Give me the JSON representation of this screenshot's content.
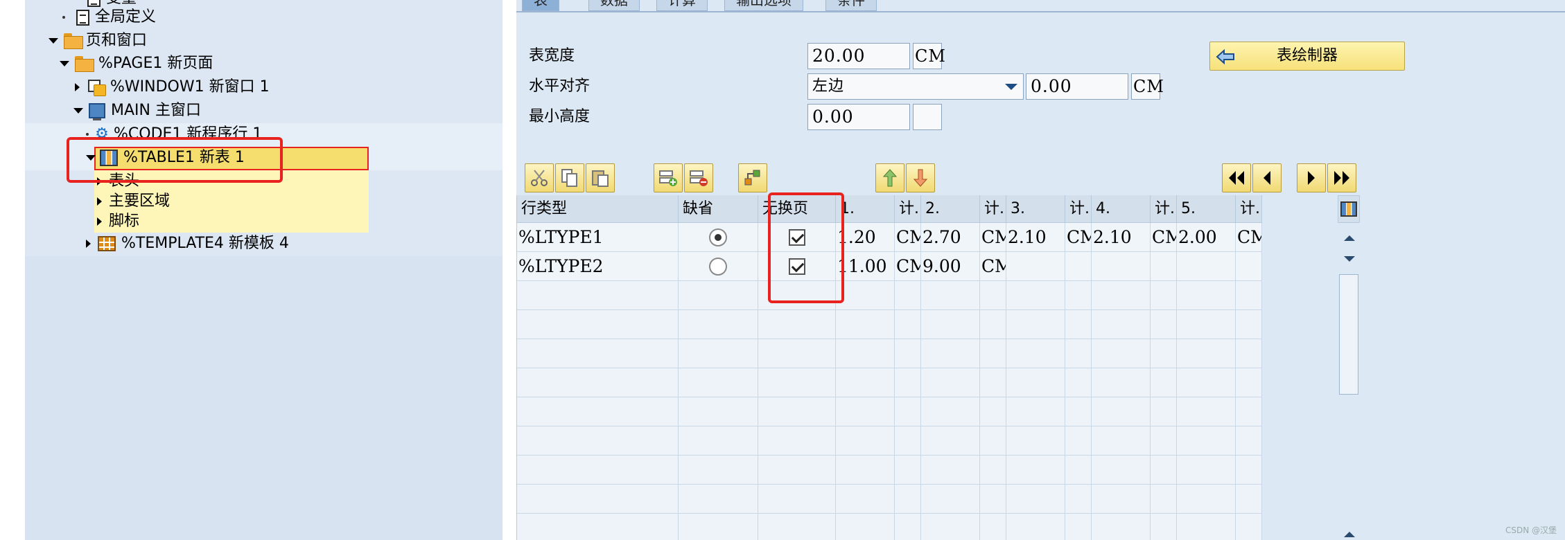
{
  "tree": {
    "top_partial": "变量",
    "global": "全局定义",
    "pages_windows": "页和窗口",
    "page1": "%PAGE1 新页面",
    "window1": "%WINDOW1 新窗口 1",
    "main": "MAIN 主窗口",
    "code1": "%CODE1 新程序行 1",
    "table1": "%TABLE1 新表 1",
    "header": "表头",
    "main_area": "主要区域",
    "footer": "脚标",
    "template4": "%TEMPLATE4 新模板 4"
  },
  "tabs": [
    "表",
    "数据",
    "计算",
    "输出选项",
    "条件"
  ],
  "form": {
    "width_label": "表宽度",
    "width_value": "20.00",
    "width_unit": "CM",
    "halign_label": "水平对齐",
    "halign_value": "左边",
    "halign_offset": "0.00",
    "halign_unit": "CM",
    "minheight_label": "最小高度",
    "minheight_value": "0.00",
    "minheight_unit": "",
    "painter_button": "表绘制器"
  },
  "toolbar": [
    "cut-icon",
    "copy-icon",
    "paste-icon",
    "insert-row-icon",
    "delete-row-icon",
    "hierarchy-icon",
    "move-up-icon",
    "move-down-icon",
    "first-page-icon",
    "prev-page-icon",
    "next-page-icon",
    "last-page-icon"
  ],
  "grid": {
    "headers": [
      "行类型",
      "缺省",
      "无换页",
      "1.",
      "计.",
      "2.",
      "计.",
      "3.",
      "计.",
      "4.",
      "计.",
      "5.",
      "计."
    ],
    "rows": [
      {
        "type": "%LTYPE1",
        "default": true,
        "no_break": true,
        "cols": [
          "1.20",
          "CM",
          "2.70",
          "CM",
          "2.10",
          "CM",
          "2.10",
          "CM",
          "2.00",
          "CM"
        ]
      },
      {
        "type": "%LTYPE2",
        "default": false,
        "no_break": true,
        "cols": [
          "11.00",
          "CM",
          "9.00",
          "CM",
          "",
          "",
          "",
          "",
          "",
          ""
        ]
      }
    ]
  },
  "watermark": "CSDN @汉堡",
  "colors": {
    "highlight": "#f5dd6e",
    "annotation_red": "#e8221e",
    "panel": "#dce8f4"
  }
}
